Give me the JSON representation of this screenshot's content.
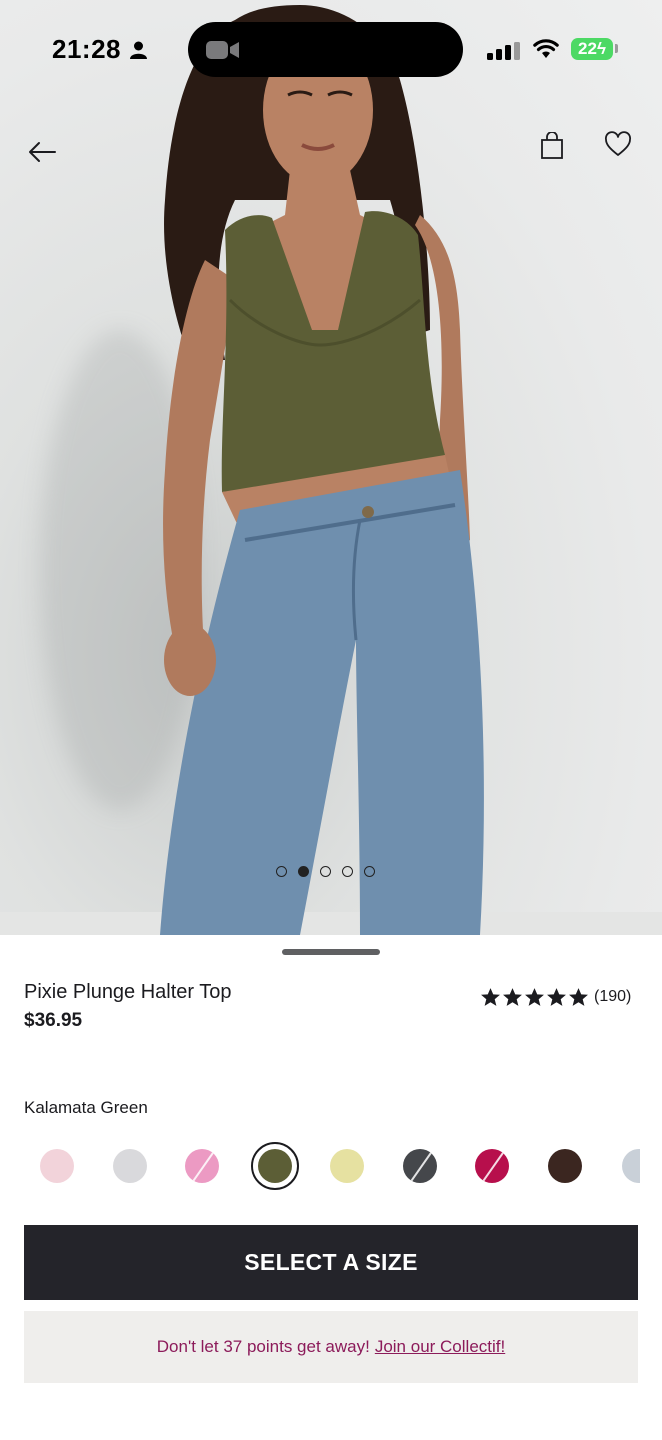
{
  "status_bar": {
    "time": "21:28",
    "battery": "22"
  },
  "product": {
    "name": "Pixie Plunge Halter Top",
    "price": "$36.95",
    "rating_stars": 5,
    "review_count": "(190)",
    "selected_color": "Kalamata Green"
  },
  "swatches": [
    {
      "name": "light-pink",
      "color": "#f2d3da",
      "slash": false
    },
    {
      "name": "silver",
      "color": "#d9d9dc",
      "slash": false
    },
    {
      "name": "pink",
      "color": "#ec9ac3",
      "slash": true
    },
    {
      "name": "kalamata-green",
      "color": "#5c5e36",
      "slash": false,
      "selected": true
    },
    {
      "name": "butter-yellow",
      "color": "#e6e1a1",
      "slash": false
    },
    {
      "name": "charcoal",
      "color": "#45474b",
      "slash": true
    },
    {
      "name": "raspberry",
      "color": "#b70f4c",
      "slash": true
    },
    {
      "name": "brown",
      "color": "#3b2620",
      "slash": false
    },
    {
      "name": "light-blue",
      "color": "#c9d0d8",
      "slash": false
    }
  ],
  "carousel": {
    "count": 5,
    "active": 1
  },
  "cta": {
    "label": "SELECT A SIZE"
  },
  "promo": {
    "text": "Don't let 37 points get away!",
    "link": "Join our Collectif!"
  },
  "icons": {
    "back": "arrow-left-icon",
    "bag": "shopping-bag-icon",
    "wishlist": "heart-icon"
  }
}
